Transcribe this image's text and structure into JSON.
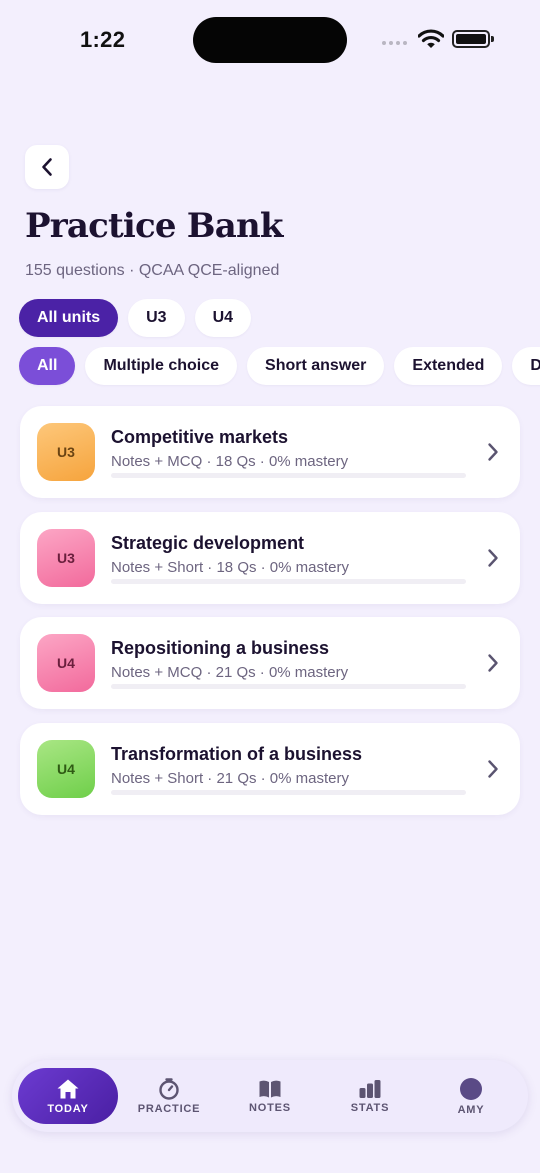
{
  "status_bar": {
    "time": "1:22"
  },
  "header": {
    "title": "Practice Bank",
    "subtitle": "155 questions · QCAA QCE-aligned"
  },
  "unit_filters": [
    {
      "label": "All units",
      "selected": true
    },
    {
      "label": "U3",
      "selected": false
    },
    {
      "label": "U4",
      "selected": false
    }
  ],
  "type_filters": [
    {
      "label": "All",
      "selected": true
    },
    {
      "label": "Multiple choice",
      "selected": false
    },
    {
      "label": "Short answer",
      "selected": false
    },
    {
      "label": "Extended",
      "selected": false
    },
    {
      "label": "D",
      "selected": false
    }
  ],
  "topics": [
    {
      "badge": "U3",
      "title": "Competitive markets",
      "meta": "Notes + MCQ · 18 Qs · 0% mastery",
      "mastery": 0,
      "badge_colors": [
        "#fdc77a",
        "#f6a43d"
      ],
      "badge_text_color": "#6b4413"
    },
    {
      "badge": "U3",
      "title": "Strategic development",
      "meta": "Notes + Short · 18 Qs · 0% mastery",
      "mastery": 0,
      "badge_colors": [
        "#fca6c5",
        "#f26a9c"
      ],
      "badge_text_color": "#6a1f3d"
    },
    {
      "badge": "U4",
      "title": "Repositioning a business",
      "meta": "Notes + MCQ · 21 Qs · 0% mastery",
      "mastery": 0,
      "badge_colors": [
        "#fca6c5",
        "#f26a9c"
      ],
      "badge_text_color": "#6a1f3d"
    },
    {
      "badge": "U4",
      "title": "Transformation of a business",
      "meta": "Notes + Short · 21 Qs · 0% mastery",
      "mastery": 0,
      "badge_colors": [
        "#a9e684",
        "#6fcf4a"
      ],
      "badge_text_color": "#2f5a14"
    }
  ],
  "tab_bar": {
    "today": "TODAY",
    "practice": "PRACTICE",
    "notes": "NOTES",
    "stats": "STATS",
    "profile": "AMY"
  }
}
